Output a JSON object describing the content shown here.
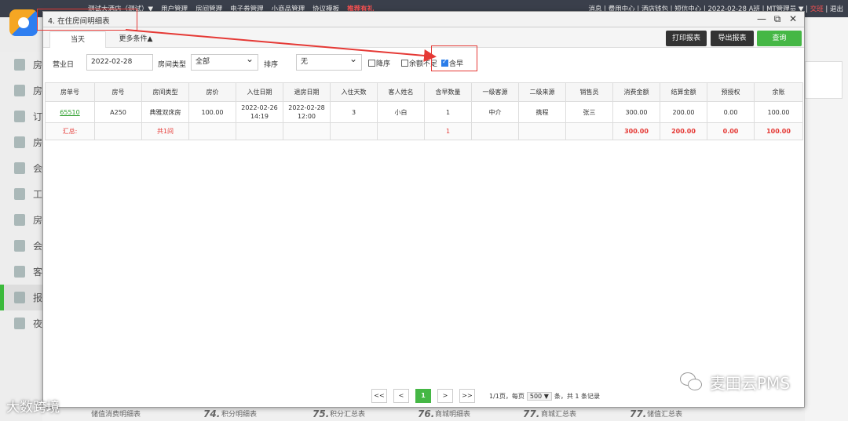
{
  "topbar": {
    "menu": [
      "测试大酒店（测试）▼",
      "用户管理",
      "房间管理",
      "电子券管理",
      "小商品管理",
      "协议模板",
      "推荐有礼"
    ],
    "right": "消息 | 费用中心 | 酒店钱包 | 短信中心 | 2022-02-28 A班 | MT管理员 ▼ |",
    "right_red": "交班",
    "right_tail": "| 退出"
  },
  "sidebar": [
    "房",
    "房",
    "订",
    "房",
    "会",
    "工",
    "房",
    "会",
    "客",
    "报",
    "夜"
  ],
  "bottom_items": [
    "储值消费明细表",
    "74.",
    "积分明细表",
    "75.",
    "积分汇总表",
    "76.",
    "商城明细表",
    "77.",
    "商城汇总表",
    "77.",
    "储值汇总表"
  ],
  "modal": {
    "title": "4. 在住房间明细表",
    "window_buttons": [
      "—",
      "⧉",
      "✕"
    ],
    "tabs": {
      "today": "当天",
      "more": "更多条件▲"
    },
    "buttons": {
      "print": "打印报表",
      "export": "导出报表",
      "query": "查询"
    },
    "filter": {
      "date_label": "营业日",
      "date_value": "2022-02-28",
      "room_type_label": "房间类型",
      "room_type_value": "全部",
      "sort_label": "排序",
      "sort_value": "无",
      "desc_label": "降序",
      "balance_label": "余额不足",
      "breakfast_label": "含早",
      "breakfast_checked": true
    },
    "table": {
      "headers": [
        "房单号",
        "房号",
        "房间类型",
        "房价",
        "入住日期",
        "退房日期",
        "入住天数",
        "客人姓名",
        "含早数量",
        "一级客源",
        "二级来源",
        "销售员",
        "消费金额",
        "结算金额",
        "预授权",
        "余账"
      ],
      "rows": [
        [
          "65510",
          "A250",
          "典雅双床房",
          "100.00",
          "2022-02-26 14:19",
          "2022-02-28 12:00",
          "3",
          "小白",
          "1",
          "中介",
          "携程",
          "张三",
          "300.00",
          "200.00",
          "0.00",
          "100.00"
        ]
      ],
      "summary": {
        "label": "汇总:",
        "rooms": "共1间",
        "breakfast": "1",
        "consume": "300.00",
        "settle": "200.00",
        "preauth": "0.00",
        "balance": "100.00"
      }
    },
    "pager": {
      "first": "<<",
      "prev": "<",
      "current": "1",
      "next": ">",
      "last": ">>",
      "info_a": "1/1页，每页",
      "size": "500 ▼",
      "info_b": "条，共 1 条记录"
    }
  },
  "watermarks": {
    "wechat": "麦田云PMS",
    "brand": "大数跨境"
  },
  "colors": {
    "accent_green": "#45b745",
    "annotation_red": "#e53935",
    "dark_button": "#333333"
  }
}
